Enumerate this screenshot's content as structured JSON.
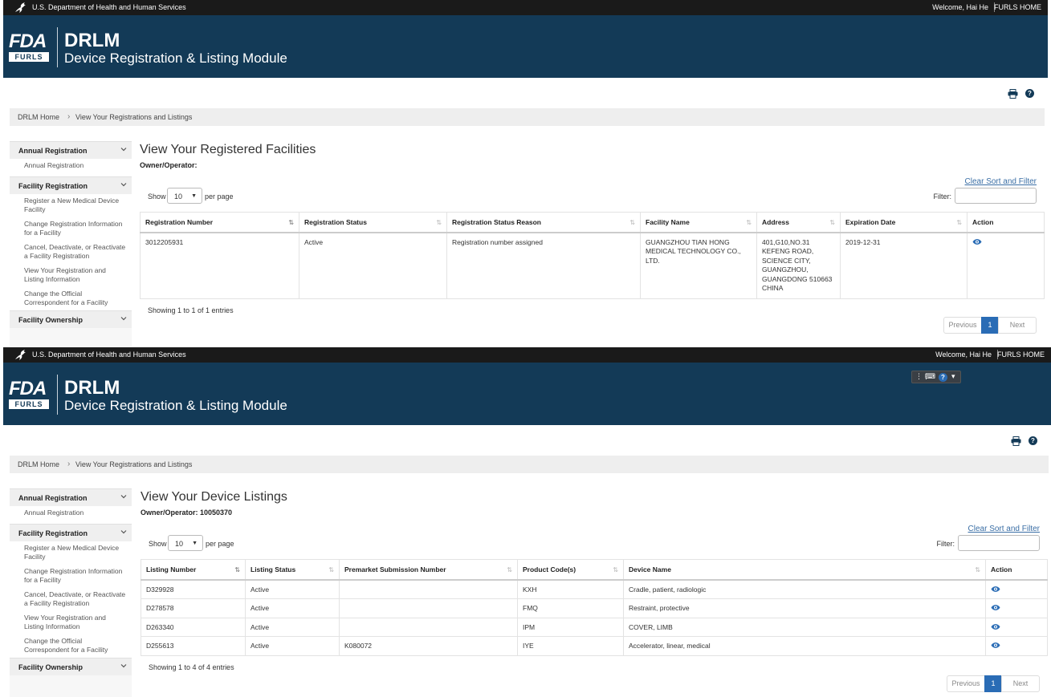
{
  "header": {
    "hhs_text": "U.S. Department of Health and Human Services",
    "welcome": "Welcome, Hai He",
    "furls_home": "FURLS HOME",
    "logo_fda": "FDA",
    "logo_furls": "FURLS",
    "app_short": "DRLM",
    "app_name": "Device Registration & Listing Module"
  },
  "breadcrumb": {
    "home": "DRLM Home",
    "current": "View Your Registrations and Listings"
  },
  "sidebar": {
    "sections": [
      {
        "label": "Annual Registration",
        "items": [
          "Annual Registration"
        ]
      },
      {
        "label": "Facility Registration",
        "items": [
          "Register a New Medical Device Facility",
          "Change Registration Information for a Facility",
          "Cancel, Deactivate, or Reactivate a Facility Registration",
          "View Your Registration and Listing Information",
          "Change the Official Correspondent for a Facility"
        ]
      },
      {
        "label": "Facility Ownership",
        "items": []
      }
    ]
  },
  "common": {
    "show": "Show",
    "per_page": "per page",
    "per_page_value": "10",
    "filter": "Filter:",
    "clear_sort": "Clear Sort and Filter",
    "previous": "Previous",
    "page": "1",
    "next": "Next"
  },
  "facilities": {
    "title": "View Your Registered Facilities",
    "owner": "Owner/Operator:",
    "columns": [
      "Registration Number",
      "Registration Status",
      "Registration Status Reason",
      "Facility Name",
      "Address",
      "Expiration Date",
      "Action"
    ],
    "rows": [
      {
        "registration_number": "3012205931",
        "status": "Active",
        "reason": "Registration number assigned",
        "facility_name": "GUANGZHOU TIAN HONG MEDICAL TECHNOLOGY CO., LTD.",
        "address": [
          "401,G10,NO.31",
          "KEFENG ROAD,",
          "SCIENCE CITY,",
          "GUANGZHOU,",
          "GUANGDONG 510663",
          "CHINA"
        ],
        "expiration": "2019-12-31"
      }
    ],
    "showing": "Showing 1 to 1 of 1 entries"
  },
  "listings": {
    "title": "View Your Device Listings",
    "owner": "Owner/Operator: 10050370",
    "columns": [
      "Listing Number",
      "Listing Status",
      "Premarket Submission Number",
      "Product Code(s)",
      "Device Name",
      "Action"
    ],
    "rows": [
      {
        "listing_number": "D329928",
        "status": "Active",
        "premarket": "",
        "product_code": "KXH",
        "device_name": "Cradle, patient, radiologic"
      },
      {
        "listing_number": "D278578",
        "status": "Active",
        "premarket": "",
        "product_code": "FMQ",
        "device_name": "Restraint, protective"
      },
      {
        "listing_number": "D263340",
        "status": "Active",
        "premarket": "",
        "product_code": "IPM",
        "device_name": "COVER, LIMB"
      },
      {
        "listing_number": "D255613",
        "status": "Active",
        "premarket": "K080072",
        "product_code": "IYE",
        "device_name": "Accelerator, linear, medical"
      }
    ],
    "showing": "Showing 1 to 4 of 4 entries"
  },
  "colors": {
    "banner": "#133a57",
    "topbar": "#1a1a1a",
    "link": "#3a6ea5",
    "pager_active": "#2a6cb5"
  },
  "icons": {
    "print": "printer-icon",
    "help": "help-icon",
    "view": "eye-icon",
    "chevron": "chevron-down-icon",
    "eagle": "hhs-eagle-icon"
  }
}
